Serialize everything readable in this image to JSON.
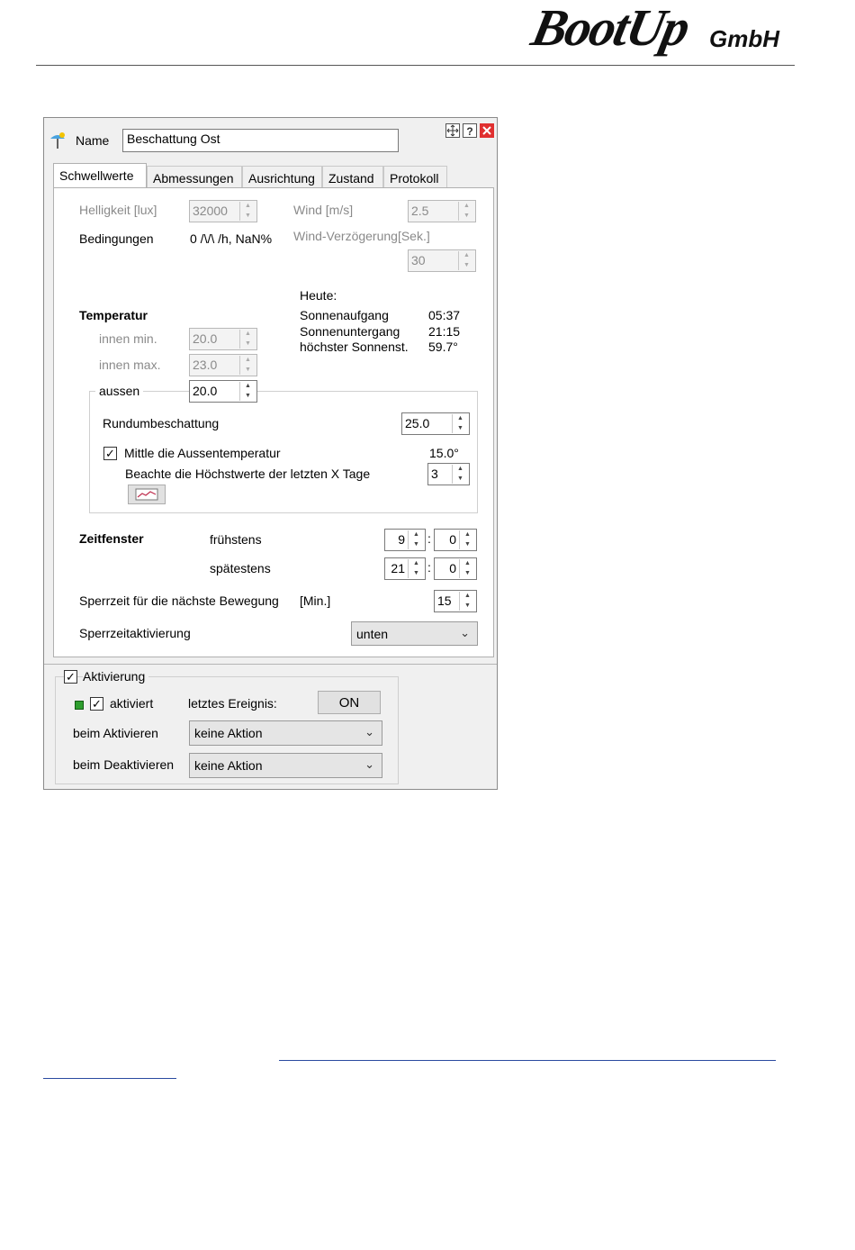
{
  "header": {
    "logo": "BootUp",
    "company_suffix": "GmbH"
  },
  "dialog": {
    "name_label": "Name",
    "name_value": "Beschattung Ost",
    "tabs": [
      "Schwellwerte",
      "Abmessungen",
      "Ausrichtung",
      "Zustand",
      "Protokoll"
    ],
    "helligkeit_label": "Helligkeit [lux]",
    "helligkeit_value": "32000",
    "wind_label": "Wind [m/s]",
    "wind_value": "2.5",
    "bedingungen_label": "Bedingungen",
    "bedingungen_value": "0 /\\/\\ /h, NaN%",
    "wind_delay_label": "Wind-Verzögerung[Sek.]",
    "wind_delay_value": "30",
    "heute_label": "Heute:",
    "sonnenaufgang_label": "Sonnenaufgang",
    "sonnenaufgang_value": "05:37",
    "sonnenuntergang_label": "Sonnenuntergang",
    "sonnenuntergang_value": "21:15",
    "hoechster_label": "höchster Sonnenst.",
    "hoechster_value": "59.7°",
    "temperatur_label": "Temperatur",
    "innen_min_label": "innen min.",
    "innen_min_value": "20.0",
    "innen_max_label": "innen max.",
    "innen_max_value": "23.0",
    "aussen_label": "aussen",
    "aussen_value": "20.0",
    "rundum_label": "Rundumbeschattung",
    "rundum_value": "25.0",
    "mittle_label": "Mittle die Aussentemperatur",
    "mittle_checked": "✓",
    "mittle_value": "15.0°",
    "beachte_label": "Beachte die Höchstwerte der letzten X Tage",
    "beachte_value": "3",
    "zeitfenster_label": "Zeitfenster",
    "fruehestens_label": "frühstens",
    "fruehestens_h": "9",
    "fruehestens_m": "0",
    "spaetestens_label": "spätestens",
    "spaetestens_h": "21",
    "spaetestens_m": "0",
    "colon": ":",
    "sperrzeit_label": "Sperrzeit für die nächste Bewegung",
    "sperrzeit_unit": "[Min.]",
    "sperrzeit_value": "15",
    "sperrzeitakt_label": "Sperrzeitaktivierung",
    "sperrzeitakt_value": "unten",
    "aktivierung_label": "Aktivierung",
    "aktivierung_checked": "✓",
    "aktiviert_label": "aktiviert",
    "aktiviert_checked": "✓",
    "letztes_label": "letztes Ereignis:",
    "letztes_value": "ON",
    "beim_akt_label": "beim Aktivieren",
    "beim_akt_value": "keine Aktion",
    "beim_deakt_label": "beim Deaktivieren",
    "beim_deakt_value": "keine Aktion",
    "chevron": "⌄",
    "colors": {
      "status_green": "#2e9e2e",
      "close_red": "#e03030"
    }
  }
}
